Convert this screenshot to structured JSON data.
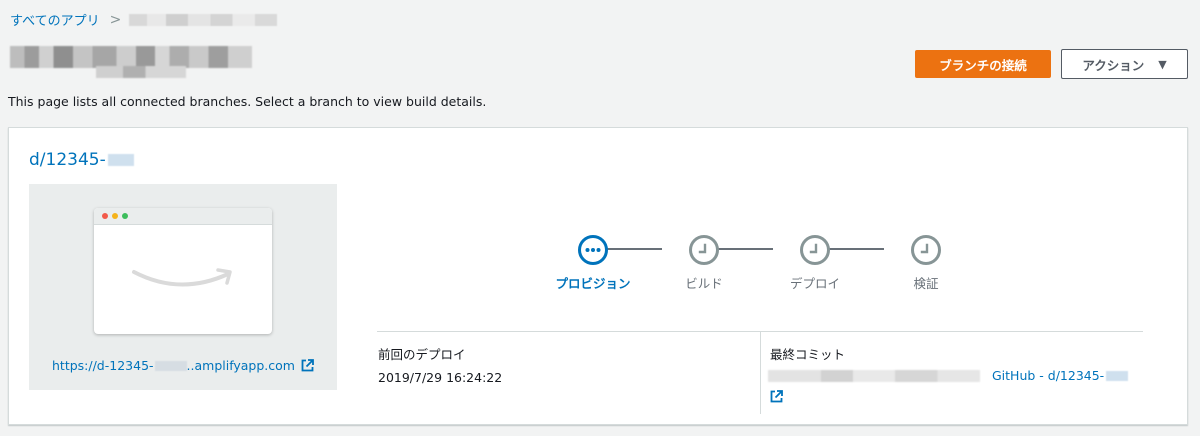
{
  "breadcrumb": {
    "root_label": "すべてのアプリ",
    "separator": ">"
  },
  "page": {
    "description": "This page lists all connected branches. Select a branch to view build details."
  },
  "header_actions": {
    "connect_branch_label": "ブランチの接続",
    "actions_label": "アクション",
    "actions_caret": "▼"
  },
  "branch": {
    "name": "d/12345-",
    "preview_url_start": "https://d-12345-",
    "preview_url_end": "..amplifyapp.com"
  },
  "pipeline": {
    "steps": [
      {
        "label": "プロビジョン",
        "state": "in-progress",
        "icon": "more-icon"
      },
      {
        "label": "ビルド",
        "state": "pending",
        "icon": "clock-icon"
      },
      {
        "label": "デプロイ",
        "state": "pending",
        "icon": "clock-icon"
      },
      {
        "label": "検証",
        "state": "pending",
        "icon": "clock-icon"
      }
    ]
  },
  "last_deploy": {
    "label": "前回のデプロイ",
    "value": "2019/7/29 16:24:22"
  },
  "last_commit": {
    "label": "最終コミット",
    "link_text": "GitHub - d/12345-"
  },
  "colors": {
    "accent": "#ec7211",
    "link": "#0073bb",
    "pending": "#879596"
  }
}
